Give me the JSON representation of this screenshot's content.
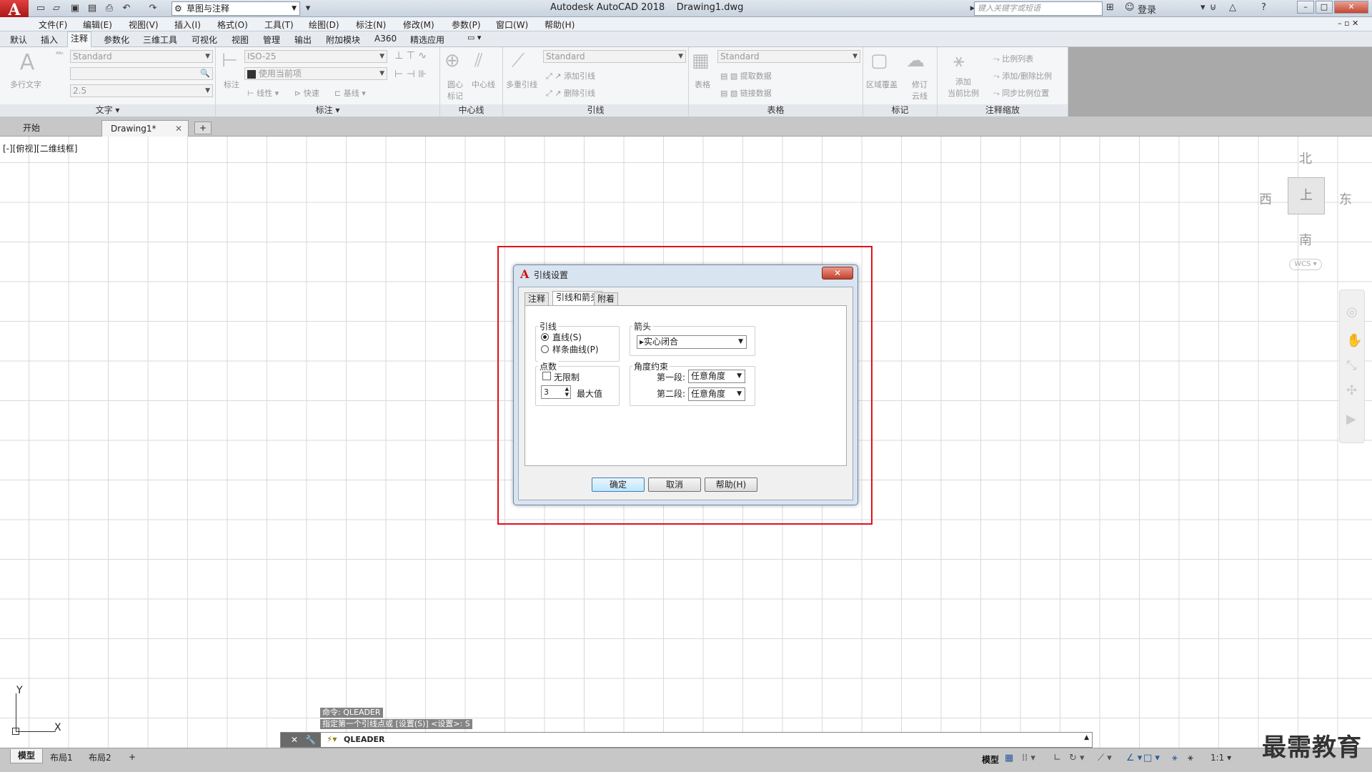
{
  "app": {
    "logo": "A",
    "title": "Autodesk AutoCAD 2018",
    "document": "Drawing1.dwg",
    "workspace": "草图与注释",
    "search_placeholder": "键入关键字或短语",
    "login": "登录",
    "help": "?"
  },
  "menus": [
    "文件(F)",
    "编辑(E)",
    "视图(V)",
    "插入(I)",
    "格式(O)",
    "工具(T)",
    "绘图(D)",
    "标注(N)",
    "修改(M)",
    "参数(P)",
    "窗口(W)",
    "帮助(H)"
  ],
  "ribbon_tabs": [
    "默认",
    "插入",
    "注释",
    "参数化",
    "三维工具",
    "可视化",
    "视图",
    "管理",
    "输出",
    "附加模块",
    "A360",
    "精选应用"
  ],
  "active_ribbon_tab": "注释",
  "ribbon": {
    "text_panel": {
      "title": "文字",
      "big_button": "多行文字",
      "style": "Standard",
      "height": "2.5"
    },
    "dim_panel": {
      "title": "标注",
      "big_button": "标注",
      "style": "ISO-25",
      "layer": "使用当前项",
      "linear": "线性",
      "quick": "快速",
      "baseline": "基线"
    },
    "center_panel": {
      "title": "中心线",
      "btn1": "圆心\n标记",
      "btn2": "中心线"
    },
    "leader_panel": {
      "title": "引线",
      "big_button": "多重引线",
      "style": "Standard",
      "add": "添加引线",
      "remove": "删除引线"
    },
    "table_panel": {
      "title": "表格",
      "big_button": "表格",
      "style": "Standard",
      "extract": "提取数据",
      "link": "链接数据"
    },
    "mark_panel": {
      "title": "标记",
      "btn1": "区域覆盖",
      "btn2": "修订\n云线"
    },
    "scale_panel": {
      "title": "注释缩放",
      "big_button": "添加\n当前比例",
      "list": "比例列表",
      "add_del": "添加/删除比例",
      "sync": "同步比例位置"
    }
  },
  "file_tabs": [
    "开始",
    "Drawing1*"
  ],
  "active_file_tab": "Drawing1*",
  "viewport_label": "[-][俯视][二维线框]",
  "viewcube": {
    "north": "北",
    "south": "南",
    "east": "东",
    "west": "西",
    "top": "上",
    "wcs": "WCS"
  },
  "dialog": {
    "title": "引线设置",
    "close": "✕",
    "tabs": [
      "注释",
      "引线和箭头",
      "附着"
    ],
    "active_tab": "引线和箭头",
    "leader_group": {
      "label": "引线",
      "options": [
        "直线(S)",
        "样条曲线(P)"
      ],
      "selected": "直线(S)"
    },
    "arrow_group": {
      "label": "箭头",
      "value": "实心闭合"
    },
    "points_group": {
      "label": "点数",
      "unlimited": "无限制",
      "unlimited_checked": false,
      "max_value": "3",
      "max_label": "最大值"
    },
    "angle_group": {
      "label": "角度约束",
      "first_label": "第一段:",
      "first_value": "任意角度",
      "second_label": "第二段:",
      "second_value": "任意角度"
    },
    "buttons": {
      "ok": "确定",
      "cancel": "取消",
      "help": "帮助(H)"
    }
  },
  "ucs": {
    "x": "X",
    "y": "Y"
  },
  "command": {
    "history1": "命令: QLEADER",
    "history2": "指定第一个引线点或 [设置(S)] <设置>: S",
    "current": "QLEADER"
  },
  "layout_tabs": [
    "模型",
    "布局1",
    "布局2"
  ],
  "active_layout_tab": "模型",
  "status": {
    "model": "模型",
    "scale": "1:1"
  },
  "watermark": "最需教育",
  "colors": {
    "highlight": "#e0101a",
    "accent": "#2a5a9a"
  }
}
